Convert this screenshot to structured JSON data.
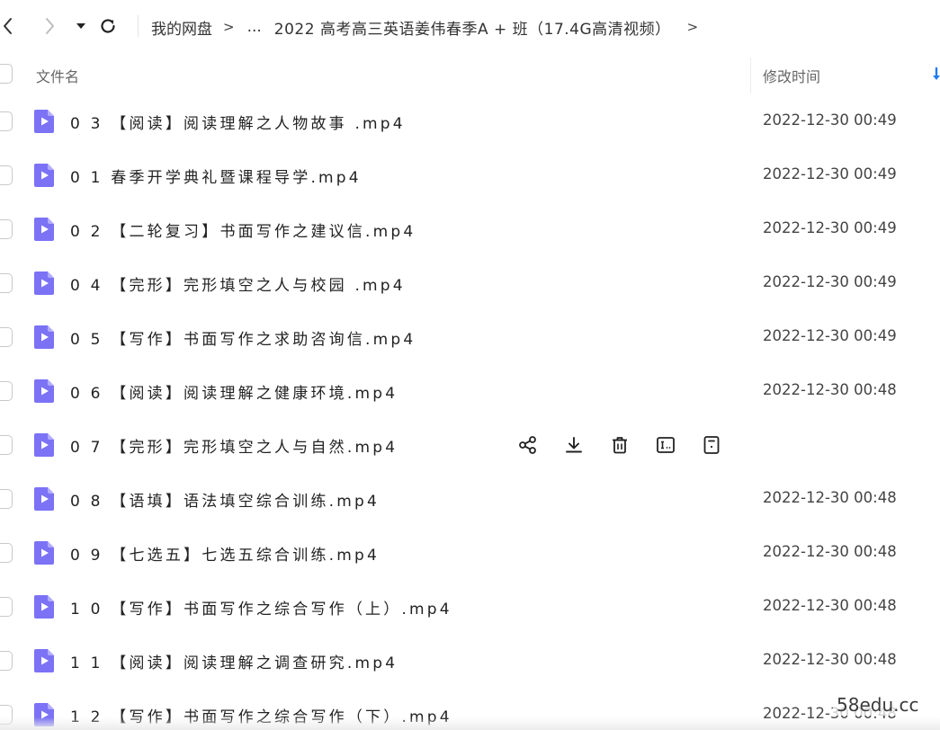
{
  "breadcrumb": {
    "root": "我的网盘",
    "ellipsis": "...",
    "current": "2022 高考高三英语姜伟春季A + 班（17.4G高清视频）"
  },
  "columns": {
    "name": "文件名",
    "modified": "修改时间"
  },
  "files": [
    {
      "name": "0 3 【阅读】阅读理解之人物故事 .mp4",
      "time": "2022-12-30 00:49"
    },
    {
      "name": "0 1   春季开学典礼暨课程导学.mp4",
      "time": "2022-12-30 00:49"
    },
    {
      "name": "0 2 【二轮复习】书面写作之建议信.mp4",
      "time": "2022-12-30 00:49"
    },
    {
      "name": "0 4 【完形】完形填空之人与校园 .mp4",
      "time": "2022-12-30 00:49"
    },
    {
      "name": "0 5 【写作】书面写作之求助咨询信.mp4",
      "time": "2022-12-30 00:49"
    },
    {
      "name": "0 6 【阅读】阅读理解之健康环境.mp4",
      "time": "2022-12-30 00:48"
    },
    {
      "name": "0 7 【完形】完形填空之人与自然.mp4",
      "time": ""
    },
    {
      "name": "0 8 【语填】语法填空综合训练.mp4",
      "time": "2022-12-30 00:48"
    },
    {
      "name": "0 9 【七选五】七选五综合训练.mp4",
      "time": "2022-12-30 00:48"
    },
    {
      "name": "1 0 【写作】书面写作之综合写作（上）.mp4",
      "time": "2022-12-30 00:48"
    },
    {
      "name": "1 1 【阅读】阅读理解之调查研究.mp4",
      "time": "2022-12-30 00:48"
    },
    {
      "name": "1 2 【写作】书面写作之综合写作（下）.mp4",
      "time": "2022-12-30 00:48"
    }
  ],
  "hover_actions": [
    "share-icon",
    "download-icon",
    "delete-icon",
    "rename-icon",
    "more-icon"
  ],
  "icons": {
    "back": "chevron-left-icon",
    "forward": "chevron-right-icon",
    "dropdown": "caret-down-icon",
    "refresh": "refresh-icon",
    "sort": "sort-arrow-icon",
    "video_file": "video-file-icon"
  },
  "colors": {
    "video_icon": "#7b72f5",
    "accent": "#1f7cf2",
    "checkbox_border": "#c9c9c9"
  },
  "watermark": "58edu.cc"
}
